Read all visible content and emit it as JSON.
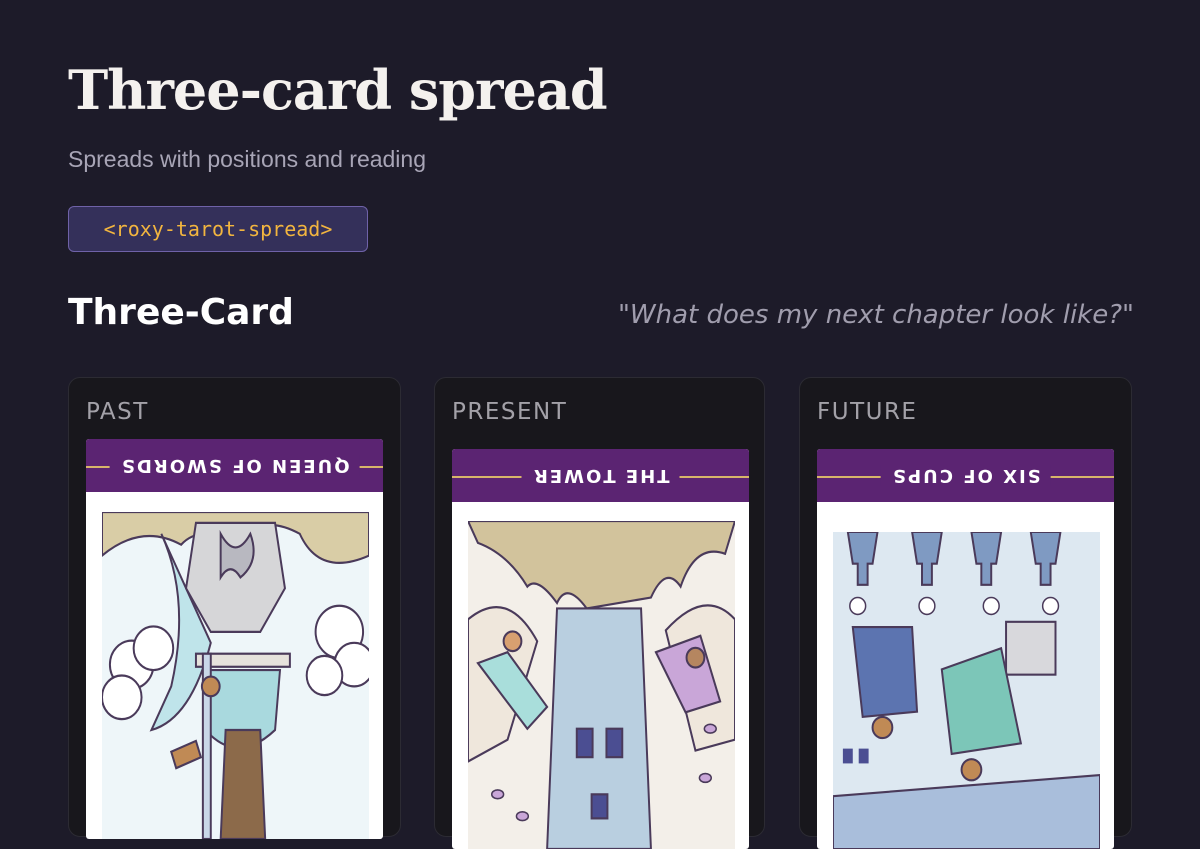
{
  "header": {
    "title": "Three-card spread",
    "subtitle": "Spreads with positions and reading",
    "component_tag": "<roxy-tarot-spread>"
  },
  "spread": {
    "name": "Three-Card",
    "question": "\"What does my next chapter look like?\"",
    "cards": [
      {
        "position": "PAST",
        "card_name": "QUEEN OF SWORDS",
        "reversed": true,
        "art_icon": "queen-of-swords-illustration"
      },
      {
        "position": "PRESENT",
        "card_name": "THE TOWER",
        "reversed": true,
        "art_icon": "the-tower-illustration"
      },
      {
        "position": "FUTURE",
        "card_name": "SIX OF CUPS",
        "reversed": true,
        "art_icon": "six-of-cups-illustration"
      }
    ]
  },
  "colors": {
    "background": "#1d1b29",
    "panel": "#18171c",
    "card_header": "#5b2472",
    "tag_text": "#f2b53f",
    "tag_background": "#34305a"
  }
}
